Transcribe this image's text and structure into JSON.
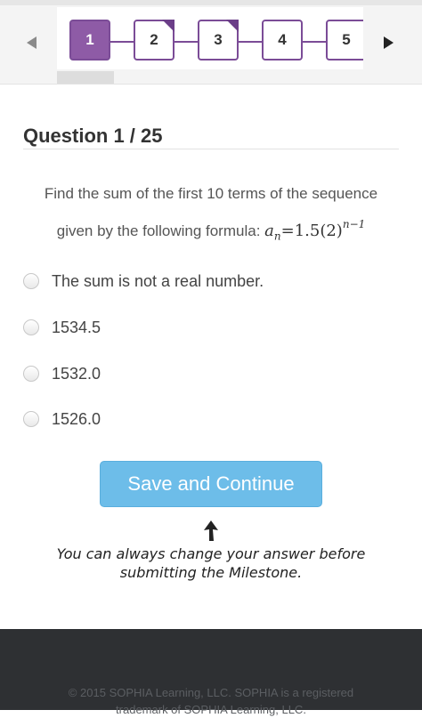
{
  "pager": {
    "items": [
      {
        "label": "1",
        "active": true,
        "answered": false
      },
      {
        "label": "2",
        "active": false,
        "answered": true
      },
      {
        "label": "3",
        "active": false,
        "answered": true
      },
      {
        "label": "4",
        "active": false,
        "answered": false
      },
      {
        "label": "5",
        "active": false,
        "answered": false
      }
    ],
    "accent": "#7b4c97"
  },
  "question": {
    "title": "Question 1 / 25",
    "prompt_line1": "Find the sum of the first 10 terms of the sequence",
    "prompt_line2": "given by the following formula:",
    "formula": {
      "var": "a",
      "sub": "n",
      "rhs": "=1.5(2)",
      "exp": "n−1"
    }
  },
  "options": [
    {
      "label": "The sum is not a real number."
    },
    {
      "label": "1534.5"
    },
    {
      "label": "1532.0"
    },
    {
      "label": "1526.0"
    }
  ],
  "save_button": {
    "label": "Save and Continue",
    "color": "#6dbde9"
  },
  "hint": {
    "line1": "You can always change your answer before",
    "line2": "submitting the Milestone."
  },
  "footer": {
    "line1": "© 2015 SOPHIA Learning, LLC. SOPHIA is a registered",
    "line2": "trademark of SOPHIA Learning, LLC."
  }
}
